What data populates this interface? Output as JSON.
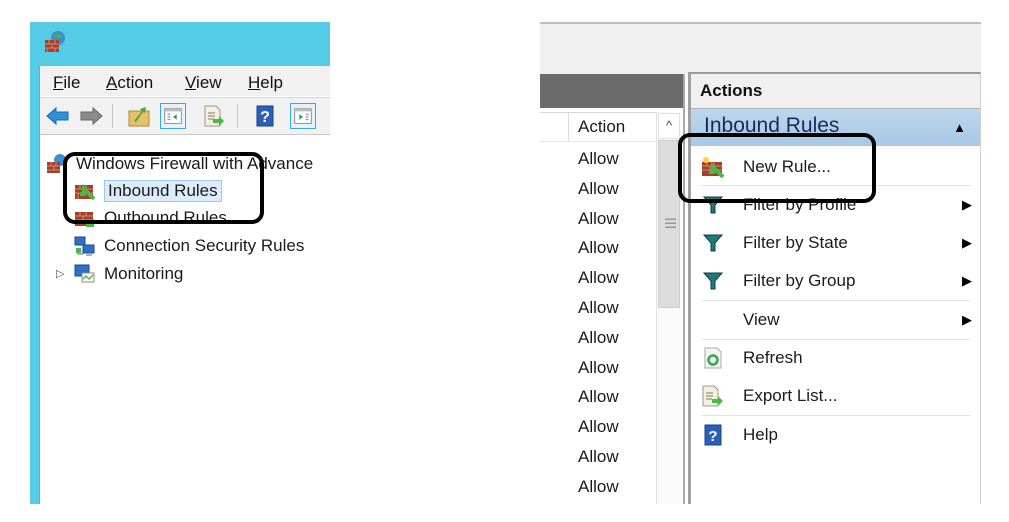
{
  "left_window": {
    "app_icon": "firewall-globe-icon",
    "menu": [
      {
        "label": "File",
        "accel": "F"
      },
      {
        "label": "Action",
        "accel": "A"
      },
      {
        "label": "View",
        "accel": "V"
      },
      {
        "label": "Help",
        "accel": "H"
      }
    ],
    "toolbar": [
      {
        "name": "back-button",
        "icon": "arrow-left-icon"
      },
      {
        "name": "forward-button",
        "icon": "arrow-right-icon"
      },
      {
        "name": "up-folder-button",
        "icon": "folder-up-icon"
      },
      {
        "name": "show-hide-console-tree-button",
        "icon": "console-tree-icon"
      },
      {
        "name": "export-list-button",
        "icon": "export-list-icon"
      },
      {
        "name": "help-button",
        "icon": "help-icon"
      },
      {
        "name": "show-hide-action-pane-button",
        "icon": "action-pane-icon"
      }
    ],
    "tree": {
      "root": "Windows Firewall with Advance",
      "items": [
        {
          "label": "Inbound Rules",
          "selected": true
        },
        {
          "label": "Outbound Rules",
          "selected": false
        },
        {
          "label": "Connection Security Rules",
          "selected": false
        },
        {
          "label": "Monitoring",
          "selected": false,
          "expandable": true
        }
      ]
    }
  },
  "middle_pane": {
    "column_header": "Action",
    "scroll_up_glyph": "^",
    "rows": [
      "Allow",
      "Allow",
      "Allow",
      "Allow",
      "Allow",
      "Allow",
      "Allow",
      "Allow",
      "Allow",
      "Allow",
      "Allow",
      "Allow"
    ]
  },
  "actions_pane": {
    "header": "Actions",
    "section_title": "Inbound Rules",
    "collapse_glyph": "▲",
    "items": [
      {
        "label": "New Rule...",
        "icon": "new-rule-icon",
        "submenu": false
      },
      {
        "label": "Filter by Profile",
        "icon": "filter-icon",
        "submenu": true
      },
      {
        "label": "Filter by State",
        "icon": "filter-icon",
        "submenu": true
      },
      {
        "label": "Filter by Group",
        "icon": "filter-icon",
        "submenu": true
      },
      {
        "label": "View",
        "icon": "",
        "submenu": true
      },
      {
        "label": "Refresh",
        "icon": "refresh-icon",
        "submenu": false
      },
      {
        "label": "Export List...",
        "icon": "export-list-icon",
        "submenu": false
      },
      {
        "label": "Help",
        "icon": "help-icon",
        "submenu": false
      }
    ],
    "submenu_glyph": "▶"
  },
  "colors": {
    "titlebar": "#56cbe6",
    "section_header": "#bcd6ec",
    "selection": "#dcecfc",
    "callout": "#000000"
  }
}
